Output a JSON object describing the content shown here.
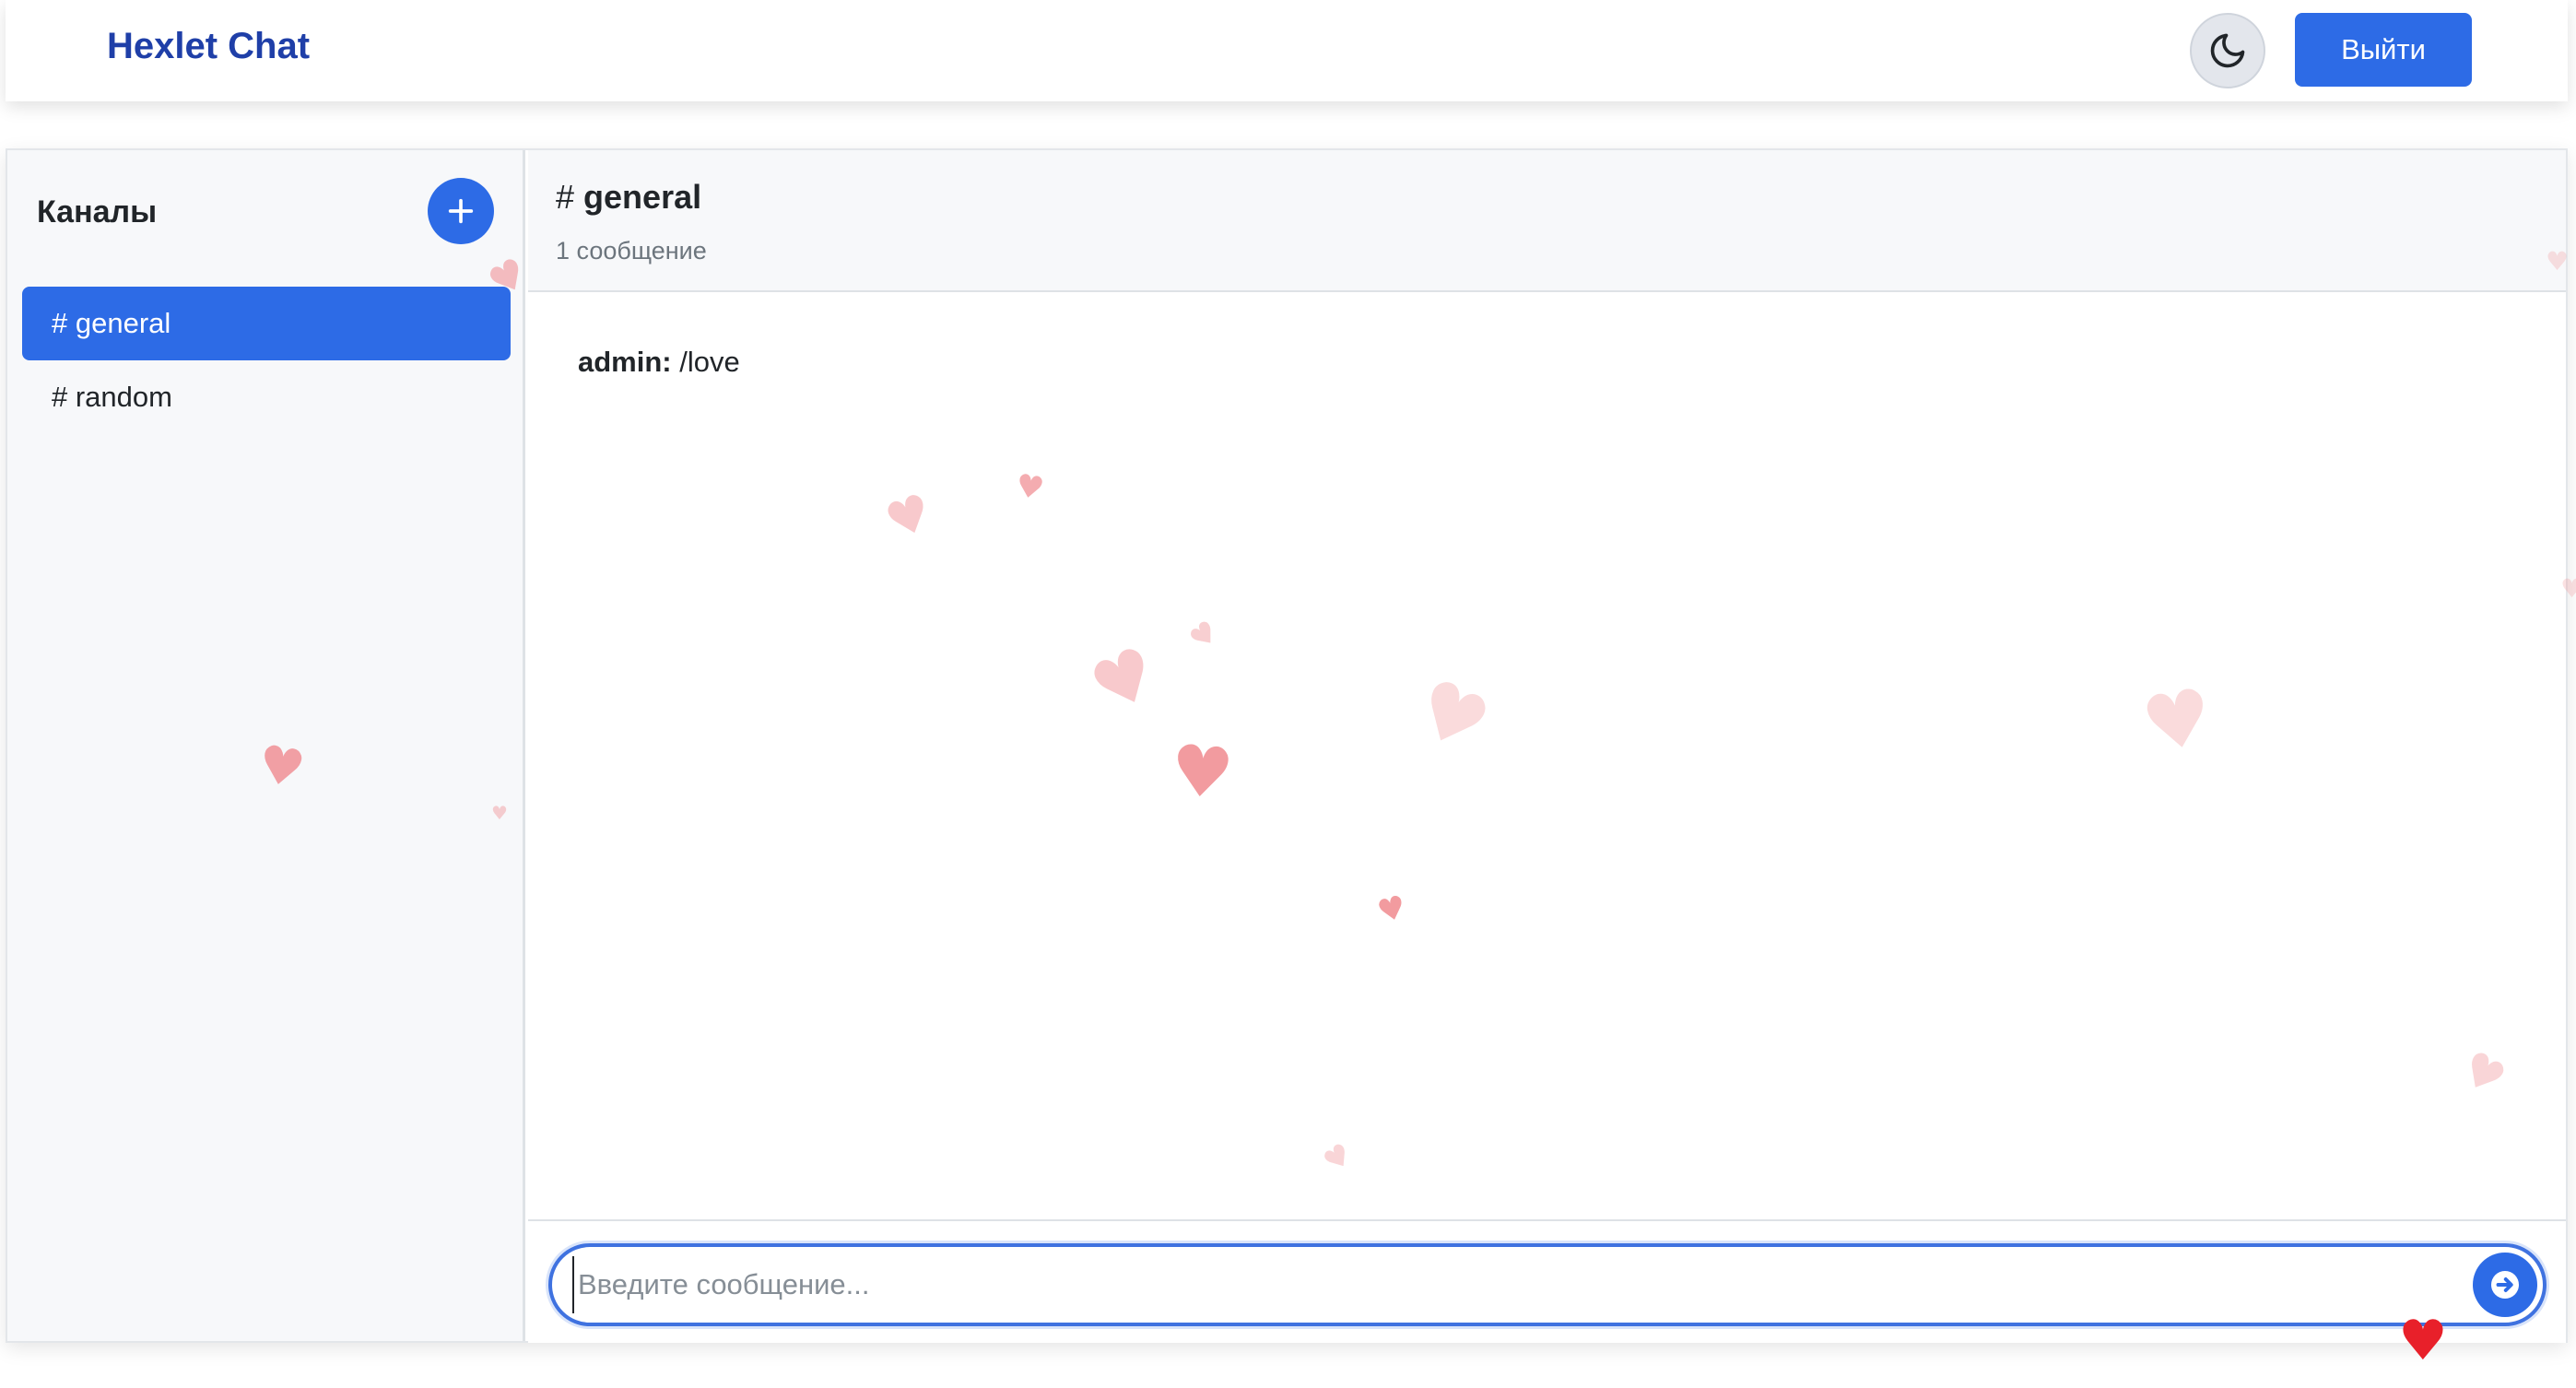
{
  "navbar": {
    "brand": "Hexlet Chat",
    "theme_toggle_icon": "moon-icon",
    "logout_label": "Выйти"
  },
  "sidebar": {
    "title": "Каналы",
    "add_icon": "plus-icon",
    "channels": [
      {
        "label": "# general",
        "active": true
      },
      {
        "label": "# random",
        "active": false
      }
    ]
  },
  "chat": {
    "channel_prefix": "#",
    "channel_name": "general",
    "message_count": "1 сообщение",
    "messages": [
      {
        "author": "admin:",
        "text": " /love"
      }
    ],
    "input": {
      "placeholder": "Введите сообщение...",
      "value": ""
    },
    "send_icon": "arrow-right-circle-icon"
  },
  "effects": {
    "heart_icon": "heart-icon",
    "accent_color": "#2d6be6",
    "brand_color": "#1f3fa8"
  }
}
